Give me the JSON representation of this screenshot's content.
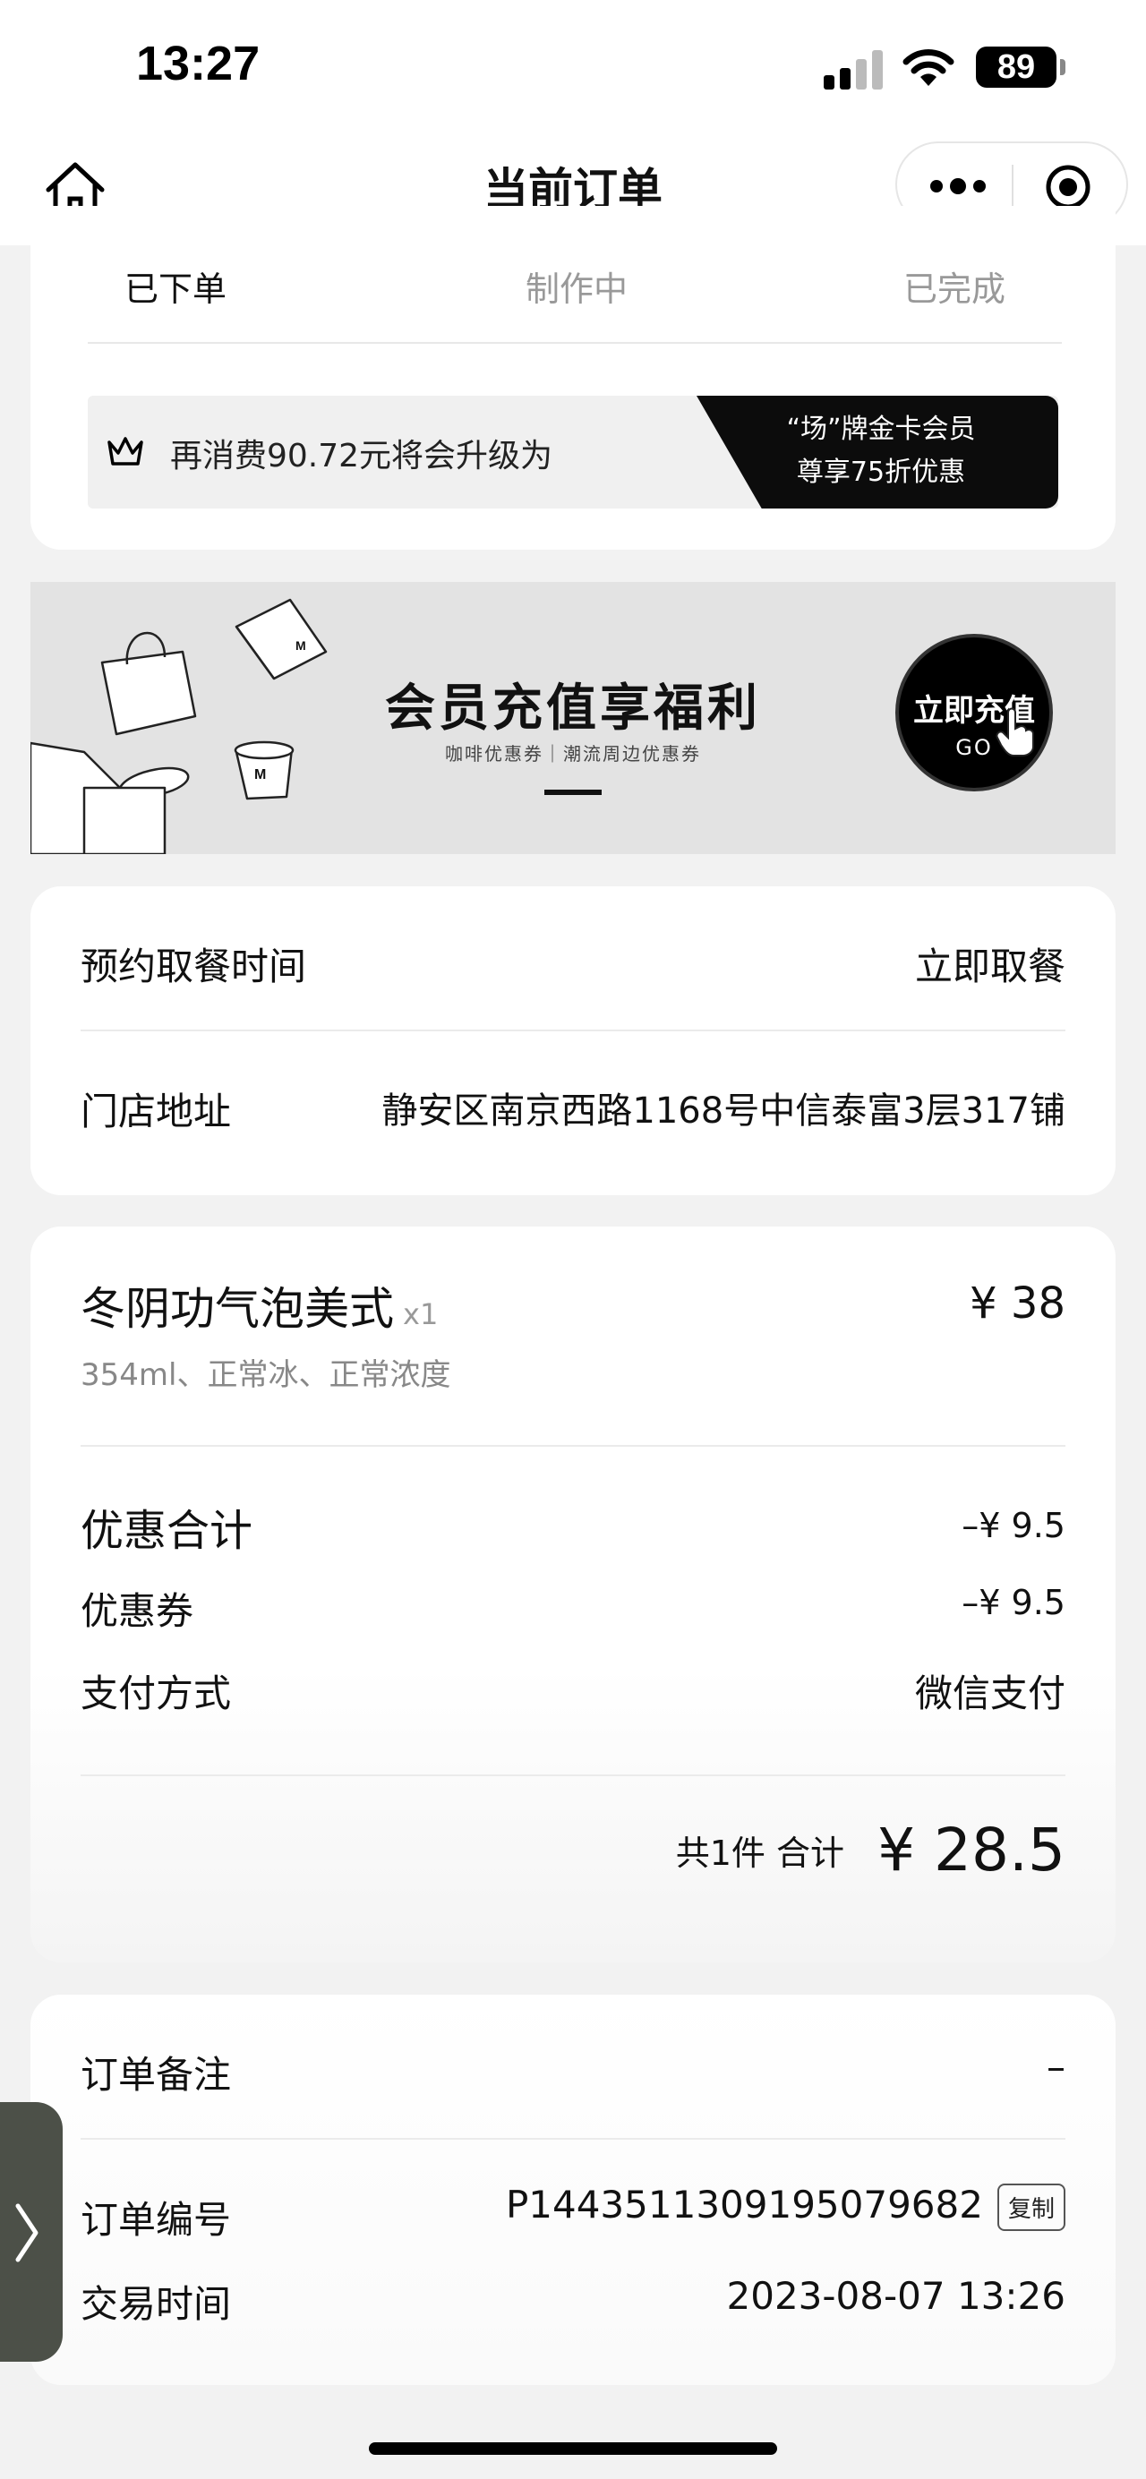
{
  "status_bar": {
    "time": "13:27",
    "battery": "89",
    "icons": [
      "signal-icon",
      "wifi-icon",
      "battery-icon"
    ]
  },
  "nav": {
    "title": "当前订单",
    "icons": [
      "home-icon",
      "more-icon",
      "target-icon"
    ]
  },
  "order_status_tabs": [
    {
      "label": "已下单",
      "active": true
    },
    {
      "label": "制作中",
      "active": false
    },
    {
      "label": "已完成",
      "active": false
    }
  ],
  "upgrade": {
    "icon": "crown-icon",
    "text": "再消费90.72元将会升级为",
    "tier_line1": "“场”牌金卡会员",
    "tier_line2": "尊享75折优惠"
  },
  "promo": {
    "title": "会员充值享福利",
    "subtitle": "咖啡优惠券｜潮流周边优惠券",
    "button_line1": "立即充值",
    "button_line2": "GO"
  },
  "pickup": {
    "time_label": "预约取餐时间",
    "time_value": "立即取餐",
    "address_label": "门店地址",
    "address_value": "静安区南京西路1168号中信泰富3层317铺"
  },
  "item": {
    "name": "冬阴功气泡美式",
    "qty": "x1",
    "price": "¥ 38",
    "spec": "354ml、正常冰、正常浓度"
  },
  "summary": {
    "discount_label": "优惠合计",
    "discount_value": "–¥ 9.5",
    "coupon_label": "优惠券",
    "coupon_value": "–¥ 9.5",
    "payment_label": "支付方式",
    "payment_value": "微信支付",
    "count_text": "共1件  合计",
    "total": "¥ 28.5"
  },
  "order_info": {
    "note_label": "订单备注",
    "note_value": "–",
    "number_label": "订单编号",
    "number_value": "P1443511309195079682",
    "copy_label": "复制",
    "time_label": "交易时间",
    "time_value": "2023-08-07 13:26"
  }
}
